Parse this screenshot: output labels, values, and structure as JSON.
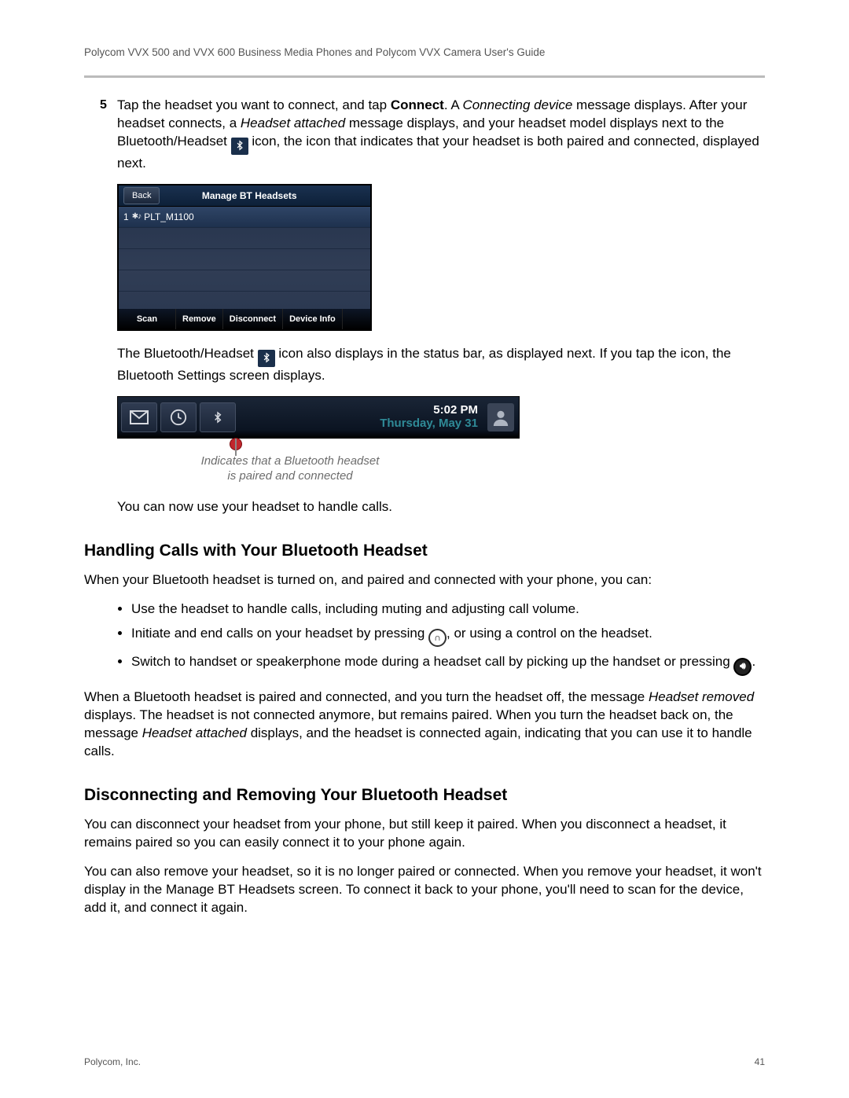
{
  "header": {
    "running_head": "Polycom VVX 500 and VVX 600 Business Media Phones and Polycom VVX Camera User's Guide"
  },
  "step": {
    "num": "5",
    "l1a": "Tap the headset you want to connect, and tap ",
    "l1b_bold": "Connect",
    "l1c": ". A ",
    "l1d_i": "Connecting device",
    "l1e": " message displays. After your headset connects, a ",
    "l1f_i": "Headset attached",
    "l1g": " message displays, and your headset model displays next to the Bluetooth/Headset ",
    "l1h": " icon, the icon that indicates that your headset is both paired and connected, displayed next."
  },
  "bt_screen": {
    "back": "Back",
    "title": "Manage BT Headsets",
    "row_num": "1",
    "row_name": "PLT_M1100",
    "btns": [
      "Scan",
      "Remove",
      "Disconnect",
      "Device Info"
    ]
  },
  "para2a": "The Bluetooth/Headset ",
  "para2b": " icon also displays in the status bar, as displayed next. If you tap the icon, the Bluetooth Settings screen displays.",
  "statusbar": {
    "time": "5:02 PM",
    "date": "Thursday, May 31"
  },
  "caption_l1": "Indicates that a Bluetooth headset",
  "caption_l2": "is paired and connected",
  "para3": "You can now use your headset to handle calls.",
  "h1": "Handling Calls with Your Bluetooth Headset",
  "p_h1": "When your Bluetooth headset is turned on, and paired and connected with your phone, you can:",
  "bul": {
    "a": "Use the headset to handle calls, including muting and adjusting call volume.",
    "b1": "Initiate and end calls on your headset by pressing  ",
    "b2": ", or using a control on the headset.",
    "c1": "Switch to handset or speakerphone mode during a headset call by picking up the handset or pressing  ",
    "c2": "."
  },
  "p_after_a": "When a Bluetooth headset is paired and connected, and you turn the headset off, the message ",
  "p_after_b_i": "Headset removed",
  "p_after_c": " displays. The headset is not connected anymore, but remains paired. When you turn the headset back on, the message ",
  "p_after_d_i": "Headset attached",
  "p_after_e": " displays, and the headset is connected again, indicating that you can use it to handle calls.",
  "h2": "Disconnecting and Removing Your Bluetooth Headset",
  "p_disc1": "You can disconnect your headset from your phone, but still keep it paired. When you disconnect a headset, it remains paired so you can easily connect it to your phone again.",
  "p_disc2": "You can also remove your headset, so it is no longer paired or connected. When you remove your headset, it won't display in the Manage BT Headsets screen. To connect it back to your phone, you'll need to scan for the device, add it, and connect it again.",
  "footer": {
    "left": "Polycom, Inc.",
    "right": "41"
  }
}
